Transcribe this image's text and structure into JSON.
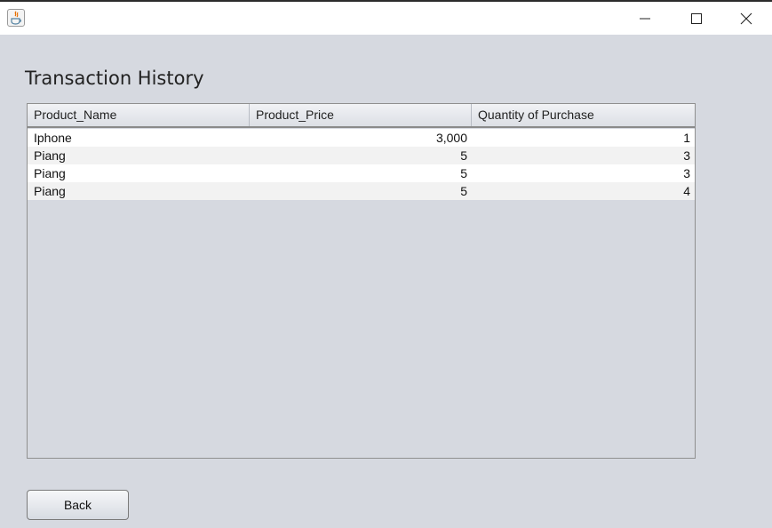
{
  "window": {
    "app_icon": "java-app-icon",
    "controls": {
      "minimize_icon": "minimize-icon",
      "maximize_icon": "maximize-icon",
      "close_icon": "close-icon"
    }
  },
  "page": {
    "title": "Transaction History"
  },
  "table": {
    "columns": [
      "Product_Name",
      "Product_Price",
      "Quantity of Purchase"
    ],
    "rows": [
      [
        "Iphone",
        "3,000",
        "1"
      ],
      [
        "Piang",
        "5",
        "3"
      ],
      [
        "Piang",
        "5",
        "3"
      ],
      [
        "Piang",
        "5",
        "4"
      ]
    ]
  },
  "buttons": {
    "back_label": "Back"
  }
}
